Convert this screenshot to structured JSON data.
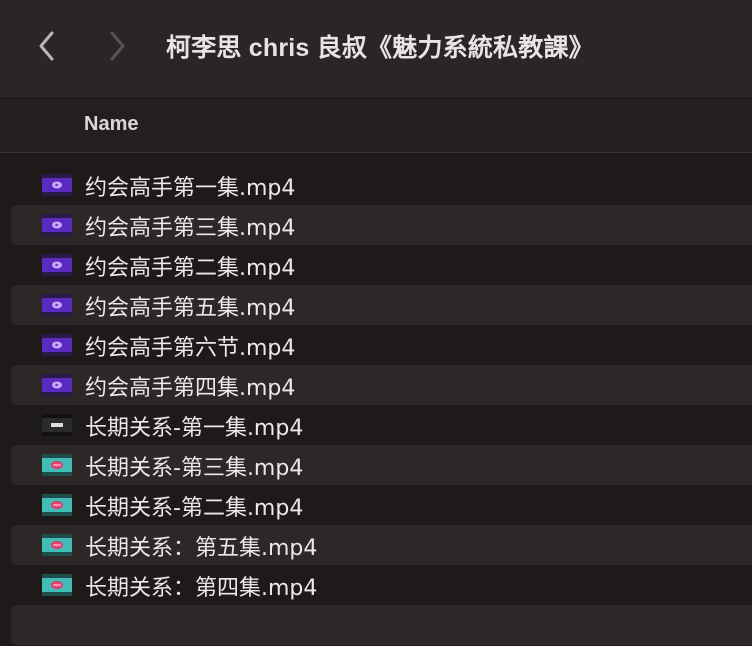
{
  "window": {
    "title": "柯李思 chris 良叔《魅力系統私教課》"
  },
  "toolbar": {
    "back_icon": "chevron-left-icon",
    "forward_icon": "chevron-right-icon"
  },
  "columns": {
    "name": "Name"
  },
  "files": [
    {
      "name": "约会高手第一集.mp4",
      "icon": "purple-video-icon"
    },
    {
      "name": "约会高手第三集.mp4",
      "icon": "purple-video-icon"
    },
    {
      "name": "约会高手第二集.mp4",
      "icon": "purple-video-icon"
    },
    {
      "name": "约会高手第五集.mp4",
      "icon": "purple-video-icon"
    },
    {
      "name": "约会高手第六节.mp4",
      "icon": "purple-video-icon"
    },
    {
      "name": "约会高手第四集.mp4",
      "icon": "purple-video-icon"
    },
    {
      "name": "长期关系-第一集.mp4",
      "icon": "dark-video-icon"
    },
    {
      "name": "长期关系-第三集.mp4",
      "icon": "teal-video-icon"
    },
    {
      "name": "长期关系-第二集.mp4",
      "icon": "teal-video-icon"
    },
    {
      "name": "长期关系：第五集.mp4",
      "icon": "teal-video-icon"
    },
    {
      "name": "长期关系：第四集.mp4",
      "icon": "teal-video-icon"
    }
  ],
  "colors": {
    "background": "#1f1a1a",
    "toolbar": "#2b2525",
    "alt_row": "#2d2727",
    "purple_icon": "#6a2fd0",
    "teal_icon": "#3fb8b4",
    "dark_icon": "#2a2a2a"
  }
}
